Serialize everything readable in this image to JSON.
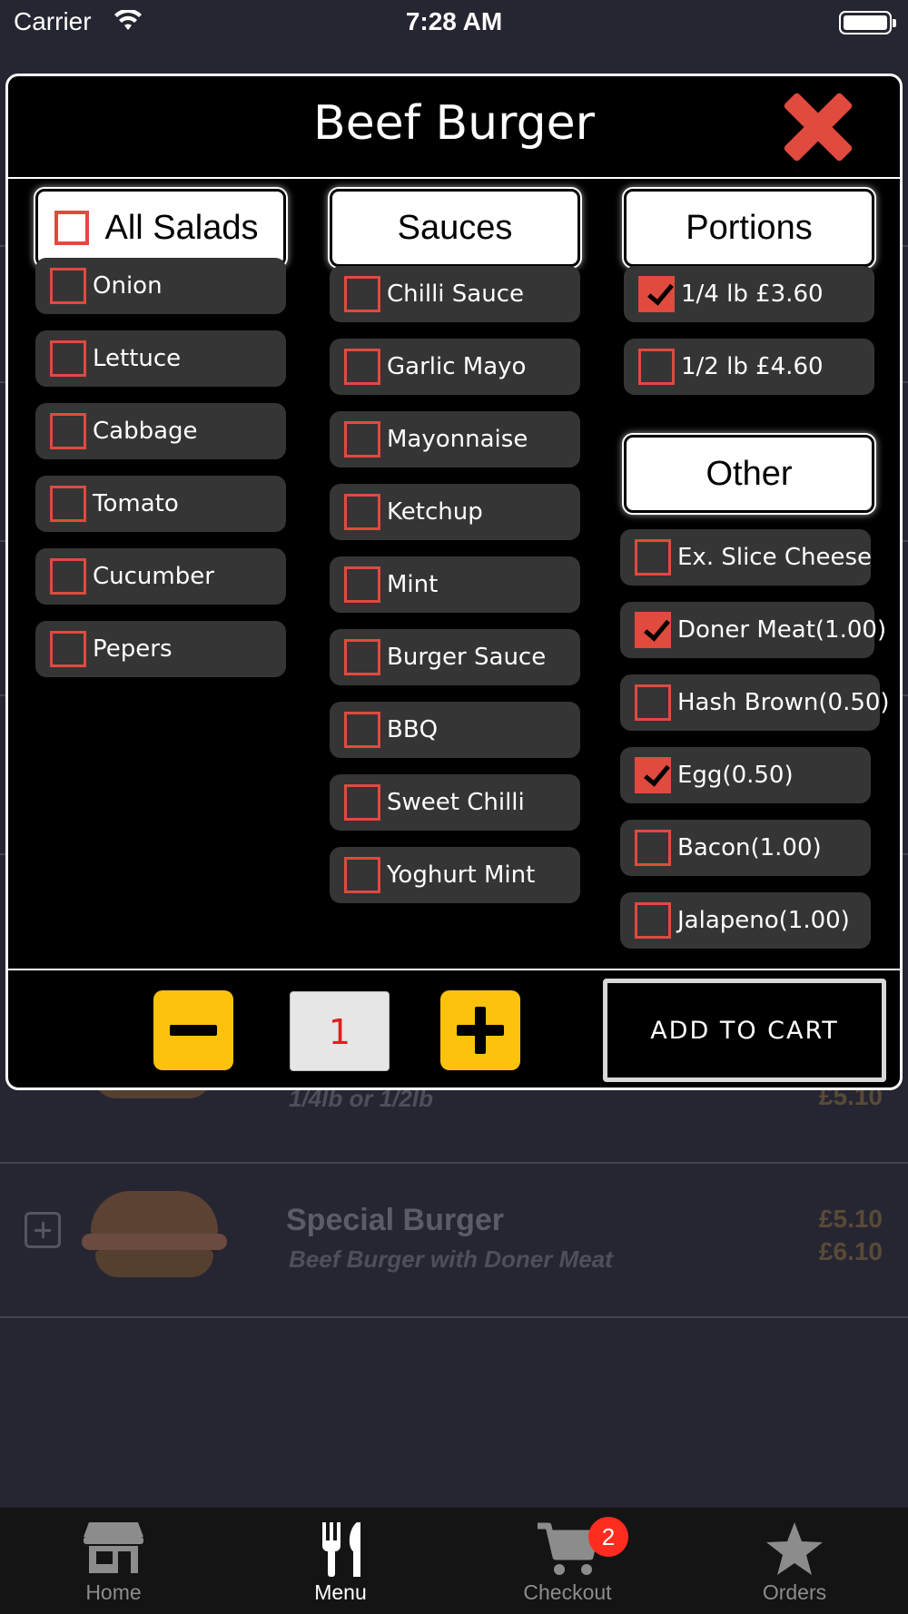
{
  "status_bar": {
    "carrier": "Carrier",
    "time": "7:28 AM"
  },
  "background_menu": {
    "items": [
      {
        "name": "",
        "description": "1/4lb or 1/2lb",
        "prices": [
          "£5.10",
          ""
        ]
      },
      {
        "name": "Special Burger",
        "description": "Beef Burger with Doner Meat",
        "prices": [
          "£5.10",
          "£6.10"
        ]
      }
    ]
  },
  "modal": {
    "title": "Beef Burger",
    "columns": {
      "salads": {
        "header": "All Salads",
        "options": [
          {
            "label": "Onion",
            "checked": false
          },
          {
            "label": "Lettuce",
            "checked": false
          },
          {
            "label": "Cabbage",
            "checked": false
          },
          {
            "label": "Tomato",
            "checked": false
          },
          {
            "label": "Cucumber",
            "checked": false
          },
          {
            "label": "Pepers",
            "checked": false
          }
        ]
      },
      "sauces": {
        "header": "Sauces",
        "options": [
          {
            "label": "Chilli Sauce",
            "checked": false
          },
          {
            "label": "Garlic Mayo",
            "checked": false
          },
          {
            "label": "Mayonnaise",
            "checked": false
          },
          {
            "label": "Ketchup",
            "checked": false
          },
          {
            "label": "Mint",
            "checked": false
          },
          {
            "label": "Burger Sauce",
            "checked": false
          },
          {
            "label": "BBQ",
            "checked": false
          },
          {
            "label": "Sweet Chilli",
            "checked": false
          },
          {
            "label": "Yoghurt Mint",
            "checked": false
          }
        ]
      },
      "portions": {
        "header": "Portions",
        "options": [
          {
            "label": "1/4 lb £3.60",
            "checked": true
          },
          {
            "label": "1/2 lb £4.60",
            "checked": false
          }
        ]
      },
      "other": {
        "header": "Other",
        "options": [
          {
            "label": "Ex. Slice Cheese",
            "checked": false
          },
          {
            "label": "Doner Meat(1.00)",
            "checked": true
          },
          {
            "label": "Hash Brown(0.50)",
            "checked": false
          },
          {
            "label": "Egg(0.50)",
            "checked": true
          },
          {
            "label": "Bacon(1.00)",
            "checked": false
          },
          {
            "label": "Jalapeno(1.00)",
            "checked": false
          }
        ]
      }
    },
    "quantity": "1",
    "add_to_cart_label": "ADD TO CART"
  },
  "tabbar": {
    "tabs": [
      {
        "label": "Home",
        "icon": "store-icon",
        "active": false
      },
      {
        "label": "Menu",
        "icon": "fork-knife-icon",
        "active": true
      },
      {
        "label": "Checkout",
        "icon": "cart-icon",
        "active": false,
        "badge": "2"
      },
      {
        "label": "Orders",
        "icon": "star-icon",
        "active": false
      }
    ]
  },
  "colors": {
    "accent_red": "#e04a3f",
    "accent_yellow": "#fdc20d",
    "badge_red": "#ff2d1f"
  }
}
